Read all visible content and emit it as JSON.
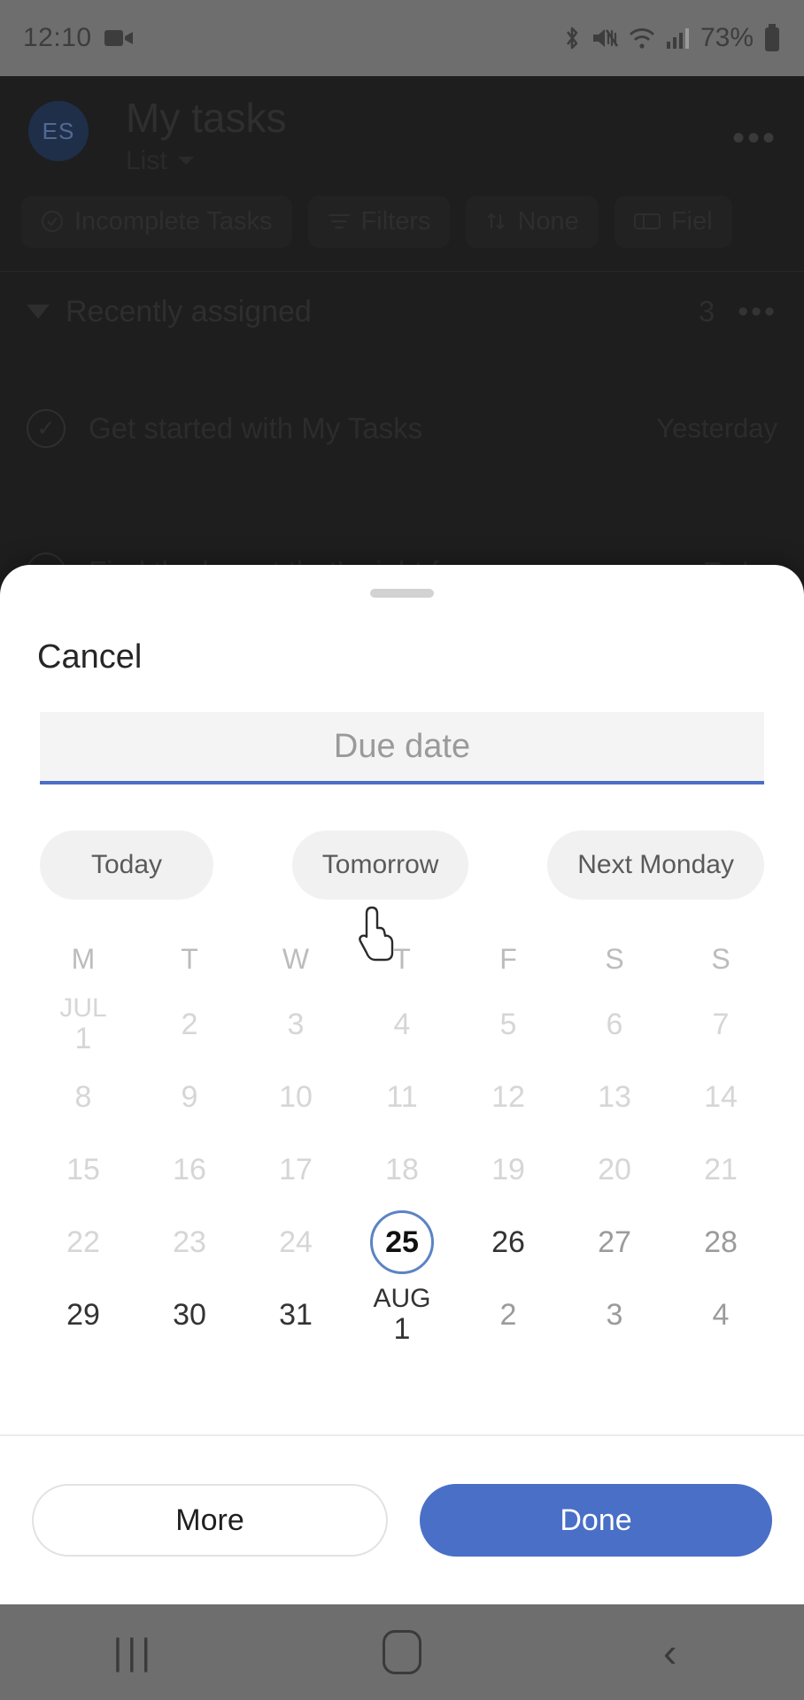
{
  "status_bar": {
    "time": "12:10",
    "battery_percent": "73%",
    "icons": [
      "video-recording-icon",
      "bluetooth-icon",
      "mute-icon",
      "wifi-icon",
      "cellular-signal-icon",
      "battery-icon"
    ]
  },
  "background_app": {
    "avatar_initials": "ES",
    "title": "My tasks",
    "view_label": "List",
    "overflow_label": "•••",
    "chips": [
      {
        "icon": "incomplete-tasks-icon",
        "label": "Incomplete Tasks"
      },
      {
        "icon": "filters-icon",
        "label": "Filters"
      },
      {
        "icon": "sort-icon",
        "label": "None"
      },
      {
        "icon": "fields-icon",
        "label": "Fiel"
      }
    ],
    "section": {
      "title": "Recently assigned",
      "count": "3",
      "overflow_label": "•••"
    },
    "tasks": [
      {
        "title": "Get started with My Tasks",
        "due": "Yesterday"
      },
      {
        "title": "Find the layout that’s right for you",
        "due": "Today"
      }
    ]
  },
  "sheet": {
    "cancel_label": "Cancel",
    "field": {
      "placeholder": "Due date",
      "value": ""
    },
    "quick_options": [
      "Today",
      "Tomorrow",
      "Next Monday"
    ],
    "calendar": {
      "weekday_headers": [
        "M",
        "T",
        "W",
        "T",
        "F",
        "S",
        "S"
      ],
      "today": "25",
      "weeks": [
        [
          {
            "month": "JUL",
            "day": "1",
            "state": "past"
          },
          {
            "day": "2",
            "state": "past"
          },
          {
            "day": "3",
            "state": "past"
          },
          {
            "day": "4",
            "state": "past"
          },
          {
            "day": "5",
            "state": "past"
          },
          {
            "day": "6",
            "state": "past"
          },
          {
            "day": "7",
            "state": "past"
          }
        ],
        [
          {
            "day": "8",
            "state": "past"
          },
          {
            "day": "9",
            "state": "past"
          },
          {
            "day": "10",
            "state": "past"
          },
          {
            "day": "11",
            "state": "past"
          },
          {
            "day": "12",
            "state": "past"
          },
          {
            "day": "13",
            "state": "past"
          },
          {
            "day": "14",
            "state": "past"
          }
        ],
        [
          {
            "day": "15",
            "state": "past"
          },
          {
            "day": "16",
            "state": "past"
          },
          {
            "day": "17",
            "state": "past"
          },
          {
            "day": "18",
            "state": "past"
          },
          {
            "day": "19",
            "state": "past"
          },
          {
            "day": "20",
            "state": "past"
          },
          {
            "day": "21",
            "state": "past"
          }
        ],
        [
          {
            "day": "22",
            "state": "past"
          },
          {
            "day": "23",
            "state": "past"
          },
          {
            "day": "24",
            "state": "past"
          },
          {
            "day": "25",
            "state": "today"
          },
          {
            "day": "26",
            "state": "normal"
          },
          {
            "day": "27",
            "state": "weekend"
          },
          {
            "day": "28",
            "state": "weekend"
          }
        ],
        [
          {
            "day": "29",
            "state": "normal"
          },
          {
            "day": "30",
            "state": "normal"
          },
          {
            "day": "31",
            "state": "normal"
          },
          {
            "month": "AUG",
            "day": "1",
            "state": "normal"
          },
          {
            "day": "2",
            "state": "weekend"
          },
          {
            "day": "3",
            "state": "weekend"
          },
          {
            "day": "4",
            "state": "weekend"
          }
        ]
      ]
    },
    "footer": {
      "more_label": "More",
      "done_label": "Done"
    }
  },
  "nav_bar": {
    "recents_label": "|||",
    "home_icon": "home-icon",
    "back_icon": "back-icon"
  },
  "colors": {
    "accent": "#4a6fc7",
    "today_ring": "#5b84c4",
    "sheet_bg": "#ffffff",
    "system_bar": "#6e6e6e"
  }
}
